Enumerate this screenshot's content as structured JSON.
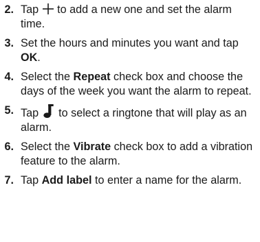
{
  "steps": [
    {
      "number": "2.",
      "before": "Tap ",
      "icon": "plus-icon",
      "after": " to add a new one and set the alarm time."
    },
    {
      "number": "3.",
      "before": "Set the hours and minutes you want and tap ",
      "bold": "OK",
      "after": "."
    },
    {
      "number": "4.",
      "before": "Select the ",
      "bold": "Repeat",
      "after": " check box and choose the days of the week you want the alarm to repeat."
    },
    {
      "number": "5.",
      "before": "Tap ",
      "icon": "music-note-icon",
      "after": " to select a ringtone that will play as an alarm."
    },
    {
      "number": "6.",
      "before": "Select the ",
      "bold": "Vibrate",
      "after": " check box to add a vibration feature to the alarm."
    },
    {
      "number": "7.",
      "before": "Tap ",
      "bold": "Add label",
      "after": " to enter a name for the alarm."
    }
  ]
}
